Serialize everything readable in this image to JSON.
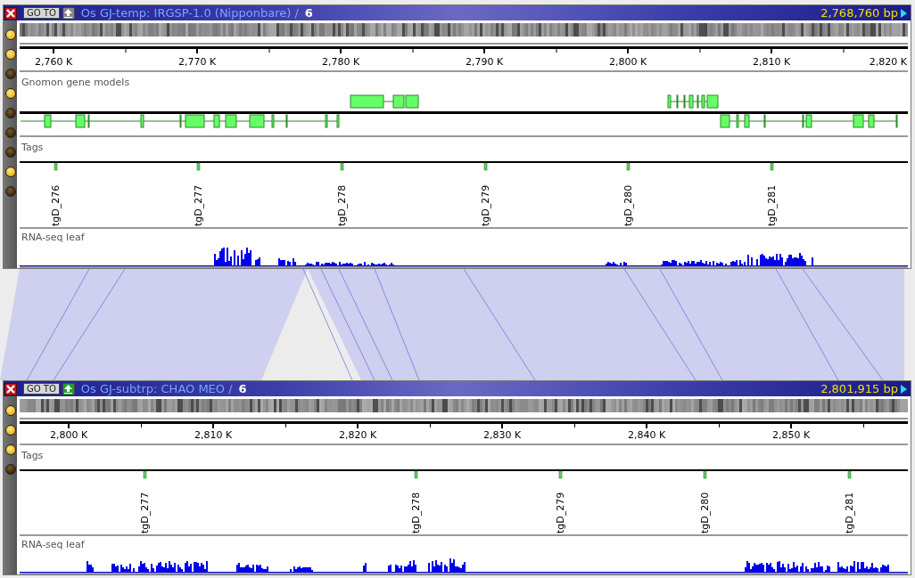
{
  "panels": [
    {
      "title": "Os GJ-temp: IRGSP-1.0 (Nipponbare) /",
      "chromosome": "6",
      "position": "2,768,760 bp",
      "goto_label": "GO TO",
      "up_enabled": false,
      "toggles": [
        {
          "on": true
        },
        {
          "on": true
        },
        {
          "on": false
        },
        {
          "on": true
        },
        {
          "on": false
        },
        {
          "on": false
        },
        {
          "on": false
        },
        {
          "on": true
        },
        {
          "on": false
        }
      ],
      "ruler_labels": [
        "2,760 K",
        "2,770 K",
        "2,780 K",
        "2,790 K",
        "2,800 K",
        "2,810 K",
        "2,820 K"
      ],
      "tracks": [
        {
          "kind": "genes",
          "label": "Gnomon gene models"
        },
        {
          "kind": "tags",
          "label": "Tags",
          "tags": [
            "tgD_276",
            "tgD_277",
            "tgD_278",
            "tgD_279",
            "tgD_280",
            "tgD_281"
          ]
        },
        {
          "kind": "coverage",
          "label": "RNA-seq leaf"
        }
      ]
    },
    {
      "title": "Os GJ-subtrp: CHAO MEO /",
      "chromosome": "6",
      "position": "2,801,915 bp",
      "goto_label": "GO TO",
      "up_enabled": true,
      "toggles": [
        {
          "on": true
        },
        {
          "on": true
        },
        {
          "on": true
        },
        {
          "on": false
        }
      ],
      "ruler_labels": [
        "2,800 K",
        "2,810 K",
        "2,820 K",
        "2,830 K",
        "2,840 K",
        "2,850 K"
      ],
      "tracks": [
        {
          "kind": "tags",
          "label": "Tags",
          "tags": [
            "tgD_277",
            "tgD_278",
            "tgD_279",
            "tgD_280",
            "tgD_281"
          ]
        },
        {
          "kind": "coverage",
          "label": "RNA-seq leaf"
        }
      ]
    }
  ]
}
